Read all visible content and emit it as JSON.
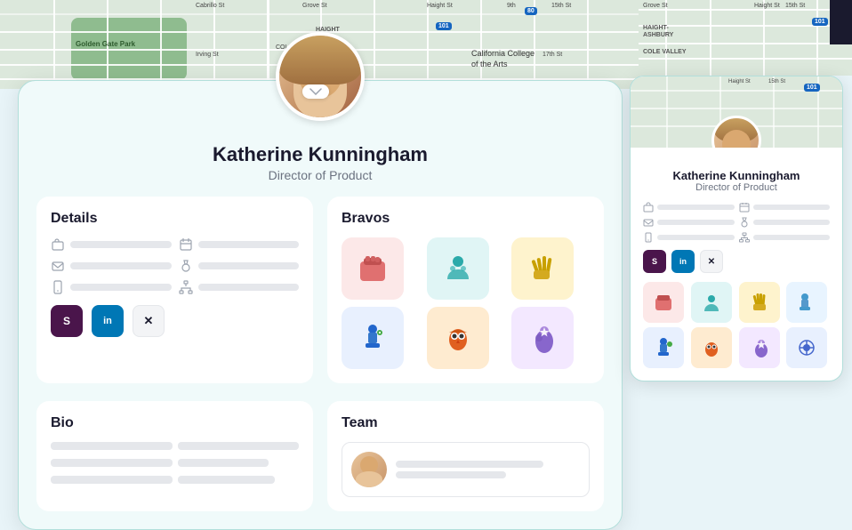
{
  "profile": {
    "name": "Katherine Kunningham",
    "title": "Director of Product",
    "sections": {
      "details": "Details",
      "bravos": "Bravos",
      "bio": "Bio",
      "team": "Team"
    }
  },
  "map": {
    "park_label": "Golden Gate Park",
    "college_label": "California College\nof the Arts",
    "area_labels": [
      "HAIGHT\nASH.",
      "HAIGHT-\nASHBURY",
      "COLE VALLEY"
    ]
  },
  "social": {
    "slack": "S",
    "linkedin": "in",
    "twitter": "✕"
  },
  "popup": {
    "name": "Katherine\nKunningham",
    "title": "Director of Product"
  }
}
